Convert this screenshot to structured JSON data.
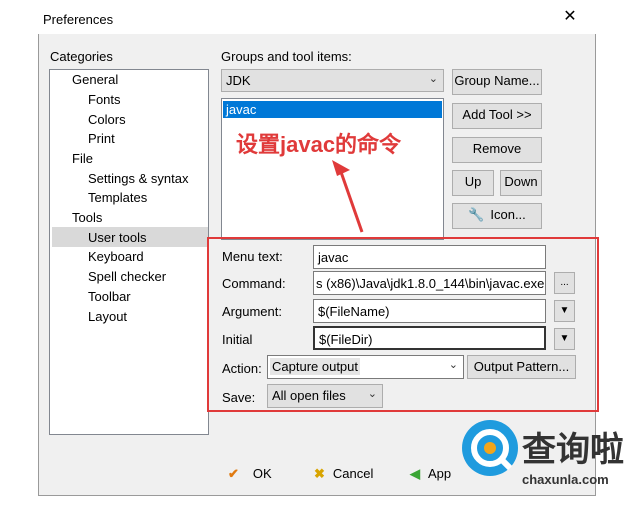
{
  "window": {
    "title": "Preferences",
    "close": "✕"
  },
  "categories": {
    "label": "Categories",
    "items": [
      {
        "label": "General"
      },
      {
        "label": "Fonts"
      },
      {
        "label": "Colors"
      },
      {
        "label": "Print"
      },
      {
        "label": "File"
      },
      {
        "label": "Settings & syntax"
      },
      {
        "label": "Templates"
      },
      {
        "label": "Tools"
      },
      {
        "label": "User tools"
      },
      {
        "label": "Keyboard"
      },
      {
        "label": "Spell checker"
      },
      {
        "label": "Toolbar"
      },
      {
        "label": "Layout"
      }
    ],
    "selected": "User tools"
  },
  "groups": {
    "label": "Groups and tool items:",
    "group_value": "JDK",
    "tools": [
      "javac"
    ]
  },
  "buttons": {
    "group_name": "Group Name...",
    "add_tool": "Add Tool >>",
    "remove": "Remove",
    "up": "Up",
    "down": "Down",
    "icon": "Icon...",
    "output_pattern": "Output Pattern...",
    "browse": "..."
  },
  "fields": {
    "menu_text": {
      "label": "Menu text:",
      "value": "javac"
    },
    "command": {
      "label": "Command:",
      "value": "s (x86)\\Java\\jdk1.8.0_144\\bin\\javac.exe"
    },
    "argument": {
      "label": "Argument:",
      "value": "$(FileName)"
    },
    "initial": {
      "label": "Initial",
      "value": "$(FileDir)"
    },
    "action": {
      "label": "Action:",
      "value": "Capture output"
    },
    "save": {
      "label": "Save:",
      "value": "All open files"
    }
  },
  "footer": {
    "ok": "OK",
    "cancel": "Cancel",
    "apply": "App"
  },
  "annotation": "设置javac的命令",
  "watermark": {
    "name": "查询啦",
    "url": "chaxunla.com"
  },
  "colors": {
    "highlight": "#0078d7",
    "annotation": "#e03a3a",
    "selection": "#d9d9d9"
  }
}
